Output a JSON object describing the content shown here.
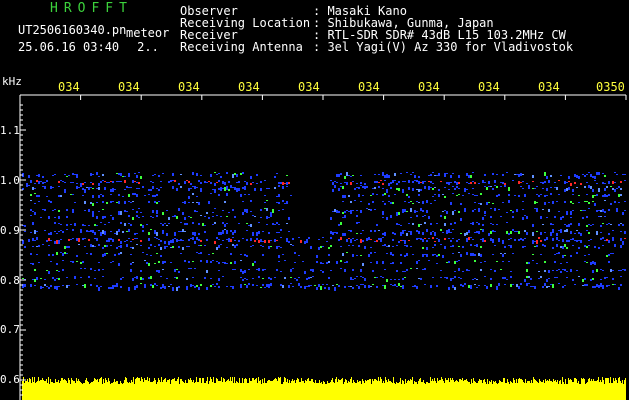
{
  "header": {
    "app_name": "HROFFT",
    "filename": "UT2506160340.pn",
    "meteor_label": "meteor",
    "datetime": "25.06.16 03:40",
    "counter": "2.."
  },
  "info": [
    {
      "label": "Observer",
      "value": ": Masaki Kano"
    },
    {
      "label": "Receiving Location",
      "value": ": Shibukawa, Gunma, Japan"
    },
    {
      "label": "Receiver",
      "value": ": RTL-SDR SDR# 43dB L15 103.2MHz CW"
    },
    {
      "label": "Receiving Antenna",
      "value": ": 3el Yagi(V) Az 330 for Vladivostok"
    }
  ],
  "axis": {
    "y_unit": "kHz",
    "y_labels": [
      "1.1",
      "1.0",
      "0.9",
      "0.8",
      "0.7",
      "0.6"
    ],
    "x_labels": [
      "034",
      "034",
      "034",
      "034",
      "034",
      "034",
      "034",
      "034",
      "034",
      "0350"
    ]
  },
  "colors": {
    "background": "#000000",
    "title_green": "#3cd23c",
    "axis_yellow": "#ffff3c",
    "signal_blue": "#1e3cff",
    "signal_red": "#ff2828",
    "signal_green": "#3cff3c",
    "noise_yellow": "#ffff00"
  }
}
